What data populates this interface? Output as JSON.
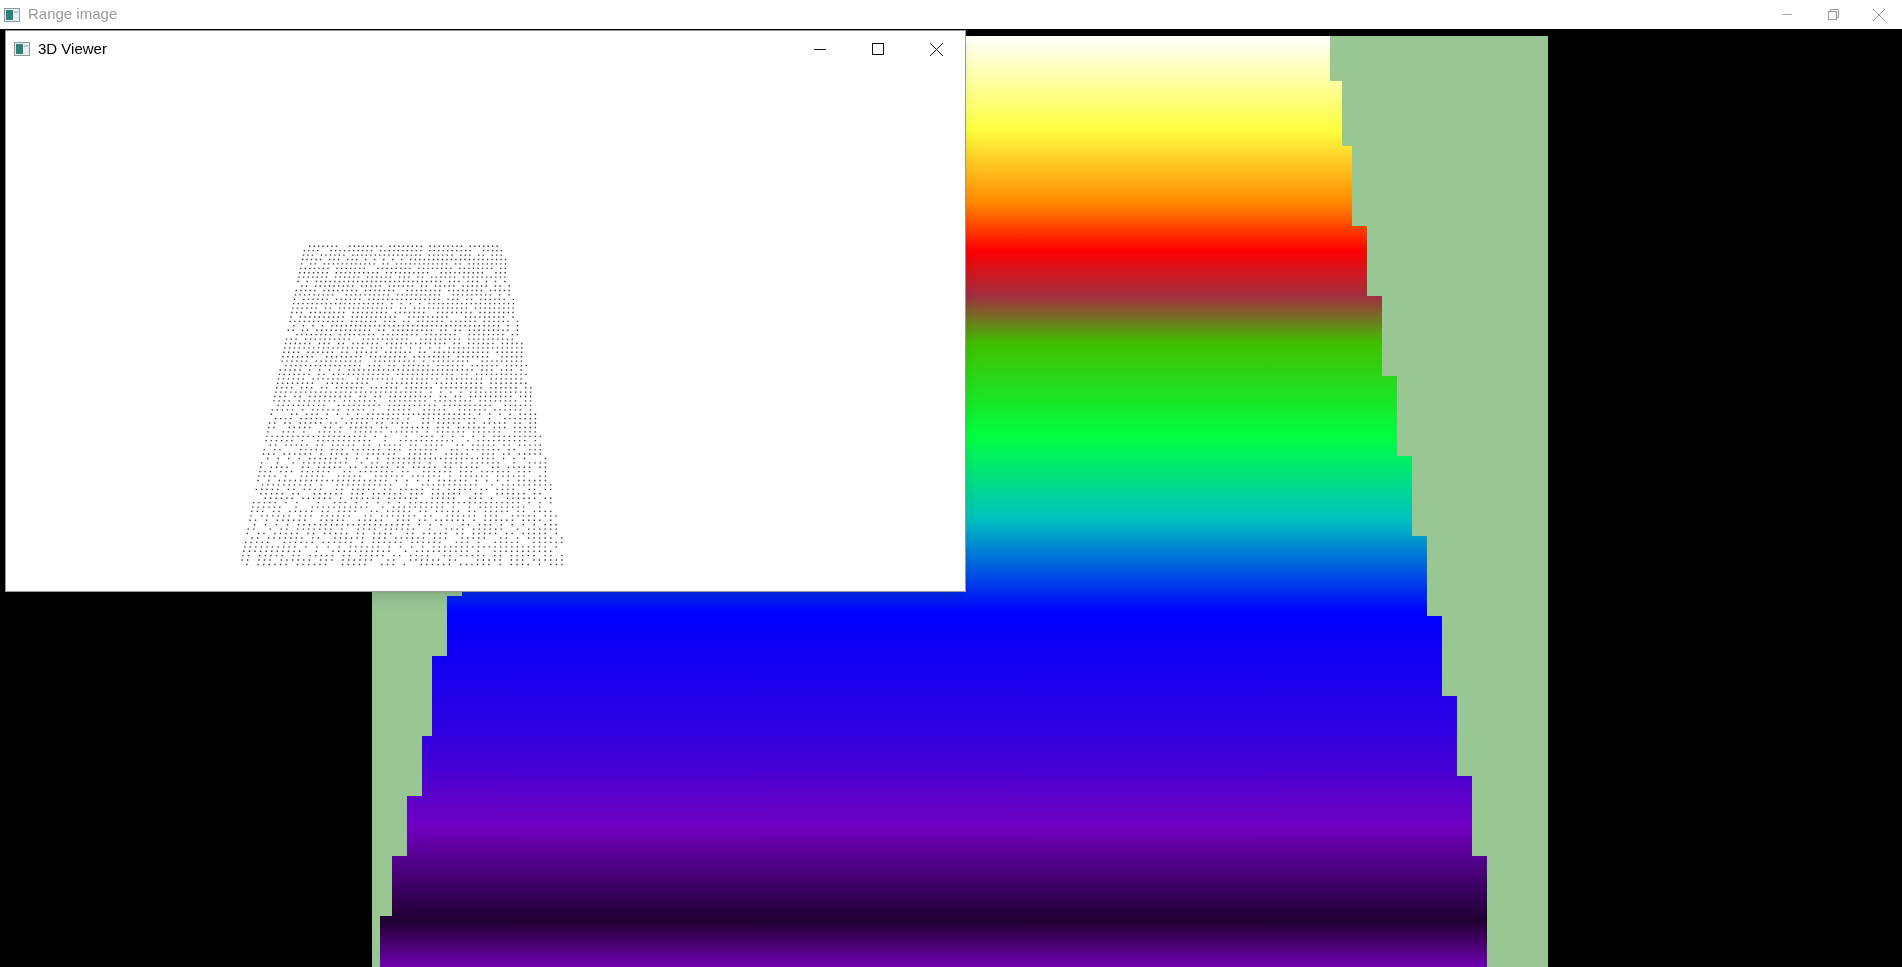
{
  "background_window": {
    "title": "Range image"
  },
  "viewer_window": {
    "title": "3D Viewer"
  }
}
